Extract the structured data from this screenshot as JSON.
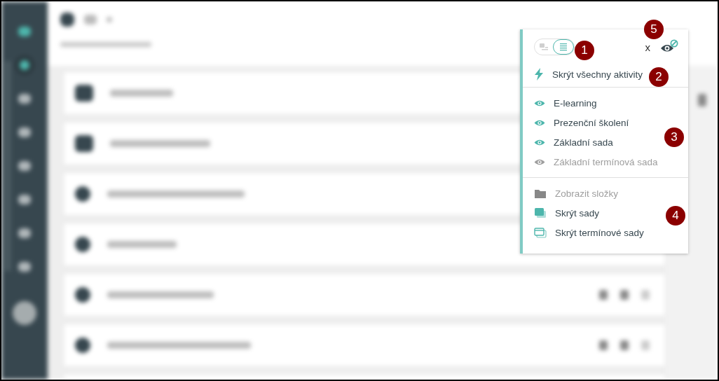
{
  "panel": {
    "view_toggle": [
      {
        "kind": "folders",
        "selected": false
      },
      {
        "kind": "list",
        "selected": true
      }
    ],
    "close": "x",
    "hide_all": "Skrýt všechny aktivity",
    "activity_types": [
      {
        "label": "E-learning",
        "visible": true
      },
      {
        "label": "Prezenční školení",
        "visible": true
      },
      {
        "label": "Základní sada",
        "visible": true
      },
      {
        "label": "Základní termínová sada",
        "visible": false
      }
    ],
    "display_options": [
      {
        "kind": "folder",
        "label": "Zobrazit složky",
        "active": false
      },
      {
        "kind": "set",
        "label": "Skrýt sady",
        "active": true
      },
      {
        "kind": "dated-set",
        "label": "Skrýt termínové sady",
        "active": true
      }
    ]
  },
  "callouts": [
    "1",
    "2",
    "3",
    "4",
    "5"
  ]
}
